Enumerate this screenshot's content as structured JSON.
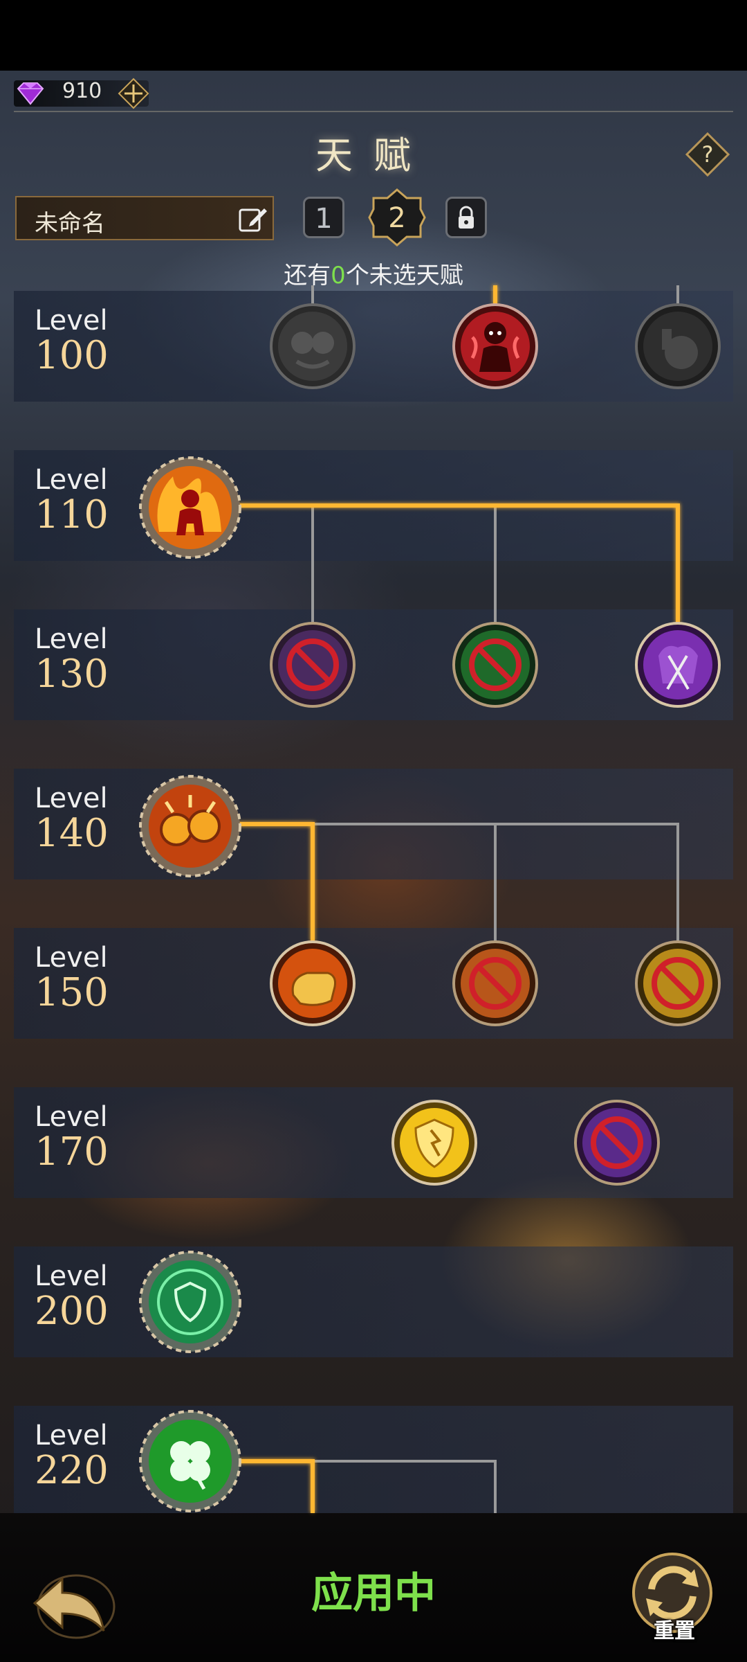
{
  "currency": {
    "amount": "910",
    "icon": "purple-gem-icon"
  },
  "header": {
    "title": "天赋"
  },
  "build": {
    "name": "未命名",
    "slots": [
      "1",
      "2",
      "lock"
    ],
    "active_slot": "2"
  },
  "remaining": {
    "prefix": "还有",
    "count": "0",
    "suffix": "个未选天赋"
  },
  "levels": [
    {
      "word": "Level",
      "value": "100",
      "talents": [
        "locked-grey",
        "selected-red-figure",
        "locked-grey-bomb"
      ]
    },
    {
      "word": "Level",
      "value": "110",
      "talents": [
        "selected-fire-figure"
      ]
    },
    {
      "word": "Level",
      "value": "130",
      "talents": [
        "disabled-purple",
        "disabled-green",
        "selected-purple-swords"
      ]
    },
    {
      "word": "Level",
      "value": "140",
      "talents": [
        "selected-fire-gears"
      ]
    },
    {
      "word": "Level",
      "value": "150",
      "talents": [
        "selected-fist",
        "disabled-orange",
        "disabled-gold"
      ]
    },
    {
      "word": "Level",
      "value": "170",
      "talents": [
        "selected-gold-shield",
        "disabled-purple-shield"
      ]
    },
    {
      "word": "Level",
      "value": "200",
      "talents": [
        "selected-green-shield"
      ]
    },
    {
      "word": "Level",
      "value": "220",
      "talents": [
        "selected-clover"
      ]
    }
  ],
  "footer": {
    "status": "应用中",
    "reset_label": "重置"
  },
  "colors": {
    "accent_green": "#7ee04c",
    "gold": "#f6d69a",
    "line_gold": "#ffb733",
    "line_grey": "#9a9a9a"
  }
}
